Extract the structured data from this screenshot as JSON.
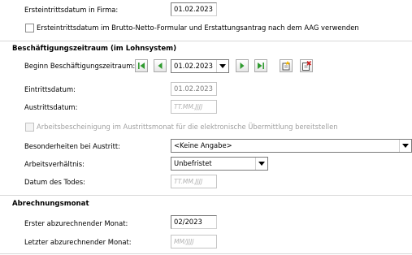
{
  "company": {
    "entry_date_label": "Ersteintrittsdatum in Firma:",
    "entry_date_value": "01.02.2023",
    "use_entry_date_checkbox_label": "Ersteintrittsdatum im Brutto-Netto-Formular und Erstattungsantrag nach dem AAG verwenden"
  },
  "employment": {
    "heading": "Beschäftigungszeitraum (im Lohnsystem)",
    "period_start_label": "Beginn Beschäftigungszeitraum:",
    "period_start_value": "01.02.2023",
    "entry_label": "Eintrittsdatum:",
    "entry_value": "01.02.2023",
    "exit_label": "Austrittsdatum:",
    "exit_placeholder": "TT.MM.JJJJ",
    "certificate_checkbox_label": "Arbeitsbescheinigung im Austrittsmonat für die elektronische Übermittlung bereitstellen",
    "exit_specifics_label": "Besonderheiten bei Austritt:",
    "exit_specifics_value": "<Keine Angabe>",
    "relationship_label": "Arbeitsverhältnis:",
    "relationship_value": "Unbefristet",
    "death_label": "Datum des Todes:",
    "death_placeholder": "TT.MM.JJJJ"
  },
  "billing": {
    "heading": "Abrechnungsmonat",
    "first_month_label": "Erster abzurechnender Monat:",
    "first_month_value": "02/2023",
    "last_month_label": "Letzter abzurechnender Monat:",
    "last_month_placeholder": "MM/JJJJ"
  },
  "icons": {
    "first": "first-record-icon",
    "prev": "previous-record-icon",
    "next": "next-record-icon",
    "last": "last-record-icon",
    "add": "new-period-icon",
    "delete": "delete-period-icon"
  },
  "colors": {
    "nav_green": "#2f9b2f",
    "delete_red": "#d02020",
    "separator": "#d8d8d8"
  }
}
